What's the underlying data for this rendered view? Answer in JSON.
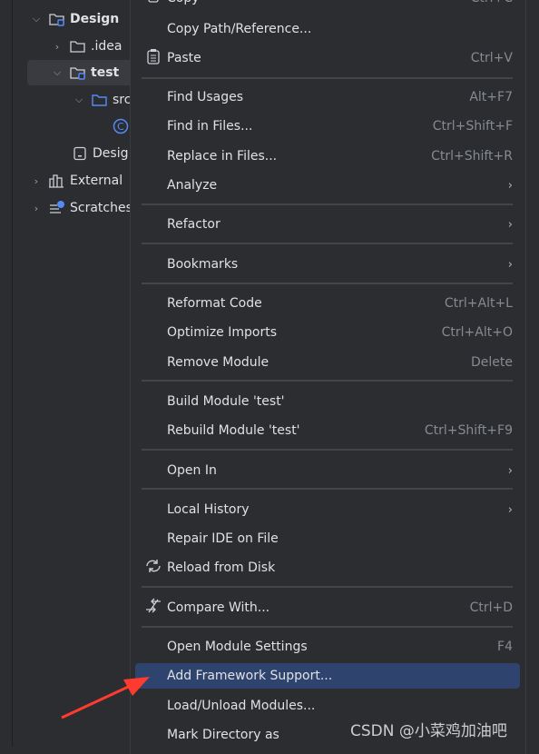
{
  "tree": [
    {
      "label": "Design",
      "expanded": true,
      "icon": "module-folder-icon"
    },
    {
      "label": ".idea",
      "expanded": false,
      "icon": "folder-icon"
    },
    {
      "label": "test",
      "expanded": true,
      "icon": "module-folder-icon",
      "selected": true
    },
    {
      "label": "src",
      "expanded": true,
      "icon": "source-folder-icon"
    },
    {
      "label": "",
      "icon": "class-icon"
    },
    {
      "label": "Desig",
      "icon": "iml-file-icon"
    },
    {
      "label": "External",
      "expanded": false,
      "icon": "libraries-icon"
    },
    {
      "label": "Scratches",
      "expanded": false,
      "icon": "scratches-icon"
    }
  ],
  "menu": [
    {
      "label": "Copy",
      "shortcut": "Ctrl+C",
      "icon": "copy-icon"
    },
    {
      "label": "Copy Path/Reference...",
      "shortcut": ""
    },
    {
      "label": "Paste",
      "shortcut": "Ctrl+V",
      "icon": "paste-icon"
    },
    {
      "label": "Find Usages",
      "shortcut": "Alt+F7"
    },
    {
      "label": "Find in Files...",
      "shortcut": "Ctrl+Shift+F"
    },
    {
      "label": "Replace in Files...",
      "shortcut": "Ctrl+Shift+R"
    },
    {
      "label": "Analyze",
      "submenu": true
    },
    {
      "label": "Refactor",
      "submenu": true
    },
    {
      "label": "Bookmarks",
      "submenu": true
    },
    {
      "label": "Reformat Code",
      "shortcut": "Ctrl+Alt+L"
    },
    {
      "label": "Optimize Imports",
      "shortcut": "Ctrl+Alt+O"
    },
    {
      "label": "Remove Module",
      "shortcut": "Delete"
    },
    {
      "label": "Build Module 'test'",
      "shortcut": ""
    },
    {
      "label": "Rebuild Module 'test'",
      "shortcut": "Ctrl+Shift+F9"
    },
    {
      "label": "Open In",
      "submenu": true
    },
    {
      "label": "Local History",
      "submenu": true
    },
    {
      "label": "Repair IDE on File",
      "shortcut": ""
    },
    {
      "label": "Reload from Disk",
      "shortcut": "",
      "icon": "reload-icon"
    },
    {
      "label": "Compare With...",
      "shortcut": "Ctrl+D",
      "icon": "compare-icon"
    },
    {
      "label": "Open Module Settings",
      "shortcut": "F4"
    },
    {
      "label": "Add Framework Support...",
      "shortcut": "",
      "highlighted": true
    },
    {
      "label": "Load/Unload Modules...",
      "shortcut": ""
    },
    {
      "label": "Mark Directory as",
      "shortcut": ""
    }
  ],
  "submenu_arrow": "›",
  "watermark": "CSDN @小菜鸡加油吧",
  "colors": {
    "highlight": "#2e436e",
    "accent_blue": "#548af7",
    "arrow": "#ff3b30"
  }
}
